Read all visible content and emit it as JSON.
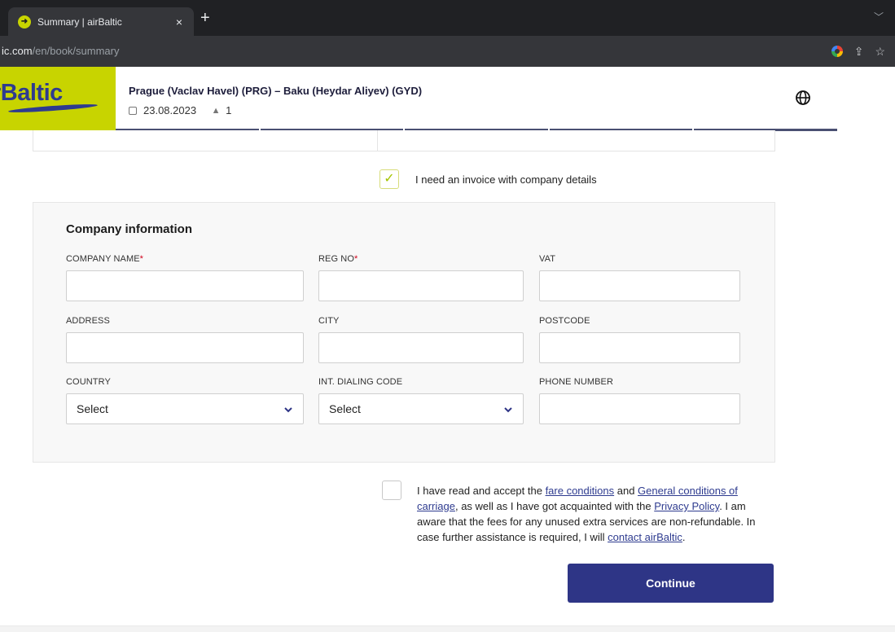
{
  "browser": {
    "tab_title": "Summary | airBaltic",
    "tab_close": "×",
    "new_tab": "+",
    "url_host": "ic.com",
    "url_path": "/en/book/summary"
  },
  "header": {
    "logo_text": "rBaltic",
    "route": "Prague (Vaclav Havel) (PRG) – Baku (Heydar Aliyev) (GYD)",
    "date": "23.08.2023",
    "passengers": "1"
  },
  "invoice": {
    "label": "I need an invoice with company details",
    "checked": true
  },
  "company": {
    "title": "Company information",
    "fields": {
      "company_name": {
        "label": "COMPANY NAME",
        "required": "*",
        "value": ""
      },
      "reg_no": {
        "label": "REG NO",
        "required": "*",
        "value": ""
      },
      "vat": {
        "label": "VAT",
        "value": ""
      },
      "address": {
        "label": "ADDRESS",
        "value": ""
      },
      "city": {
        "label": "CITY",
        "value": ""
      },
      "postcode": {
        "label": "POSTCODE",
        "value": ""
      },
      "country": {
        "label": "COUNTRY",
        "value": "Select"
      },
      "dialing_code": {
        "label": "INT. DIALING CODE",
        "value": "Select"
      },
      "phone": {
        "label": "PHONE NUMBER",
        "value": ""
      }
    }
  },
  "terms": {
    "t1": "I have read and accept the ",
    "link_fare": "fare conditions",
    "t2": " and ",
    "link_general": "General conditions of carriage",
    "t3": ", as well as I have got acquainted with the ",
    "link_privacy": "Privacy Policy",
    "t4": ". I am aware that the fees for any unused extra services are non-refundable. In case further assistance is required, I will ",
    "link_contact": "contact airBaltic",
    "t5": "."
  },
  "continue_label": "Continue",
  "colors": {
    "brand_lime": "#c8d400",
    "brand_navy": "#2e3586"
  }
}
